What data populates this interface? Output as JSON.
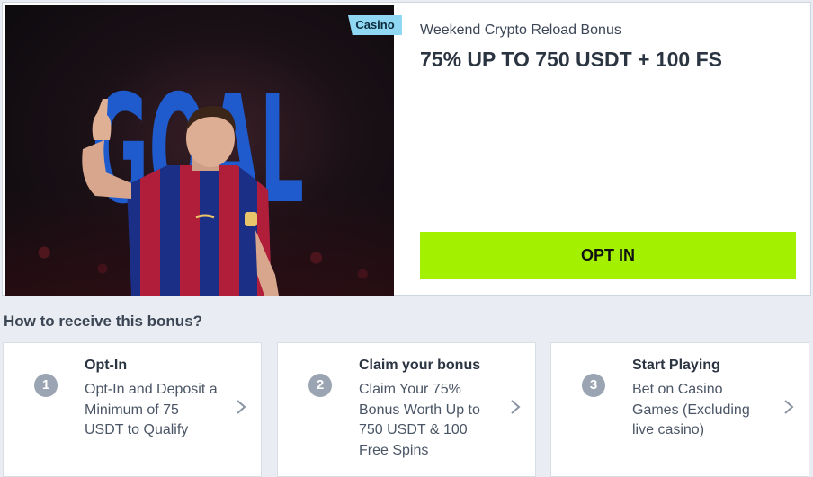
{
  "promo": {
    "tag": "Casino",
    "title": "Weekend Crypto Reload Bonus",
    "headline": "75% UP TO 750 USDT + 100 FS",
    "cta": "OPT IN",
    "image_text": "GOAL"
  },
  "how_to": {
    "title": "How to receive this bonus?",
    "steps": [
      {
        "number": "1",
        "title": "Opt-In",
        "description": "Opt-In and Deposit a Minimum of 75 USDT to Qualify"
      },
      {
        "number": "2",
        "title": "Claim your bonus",
        "description": "Claim Your 75% Bonus Worth Up to 750 USDT & 100 Free Spins"
      },
      {
        "number": "3",
        "title": "Start Playing",
        "description": "Bet on Casino Games (Excluding live casino)"
      }
    ]
  },
  "colors": {
    "cta": "#a3f000",
    "tag": "#8fd7f2",
    "page_bg": "#e9edf3",
    "goal_text": "#1f5fd6",
    "step_badge": "#9aa4b2"
  }
}
